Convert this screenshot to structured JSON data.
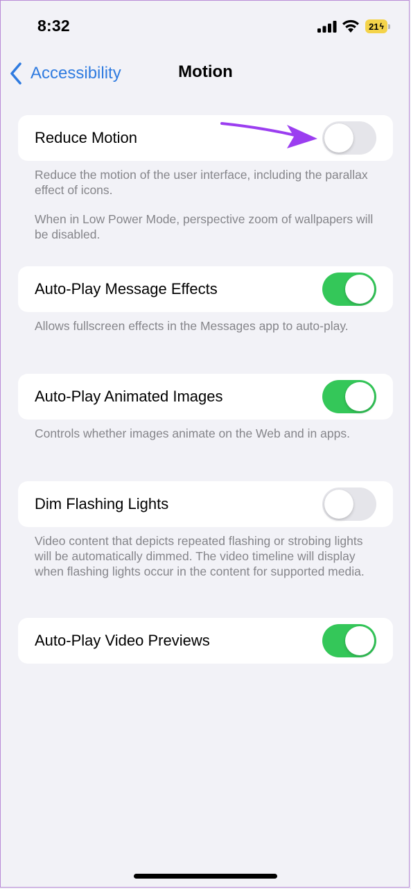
{
  "status_bar": {
    "time": "8:32",
    "battery_level": "21",
    "icons": [
      "signal-icon",
      "wifi-icon",
      "battery-charging-icon"
    ]
  },
  "nav": {
    "back_label": "Accessibility",
    "title": "Motion"
  },
  "settings": [
    {
      "label": "Reduce Motion",
      "enabled": false,
      "footnotes": [
        "Reduce the motion of the user interface, including the parallax effect of icons.",
        "When in Low Power Mode, perspective zoom of wallpapers will be disabled."
      ]
    },
    {
      "label": "Auto-Play Message Effects",
      "enabled": true,
      "footnotes": [
        "Allows fullscreen effects in the Messages app to auto-play."
      ]
    },
    {
      "label": "Auto-Play Animated Images",
      "enabled": true,
      "footnotes": [
        "Controls whether images animate on the Web and in apps."
      ]
    },
    {
      "label": "Dim Flashing Lights",
      "enabled": false,
      "footnotes": [
        "Video content that depicts repeated flashing or strobing lights will be automatically dimmed. The video timeline will display when flashing lights occur in the content for supported media."
      ]
    },
    {
      "label": "Auto-Play Video Previews",
      "enabled": true,
      "footnotes": []
    }
  ],
  "colors": {
    "accent": "#2f7be0",
    "toggle_on": "#34c759",
    "toggle_off": "#e5e5ea",
    "background": "#f2f2f7",
    "annotation_arrow": "#9b3ef0"
  }
}
